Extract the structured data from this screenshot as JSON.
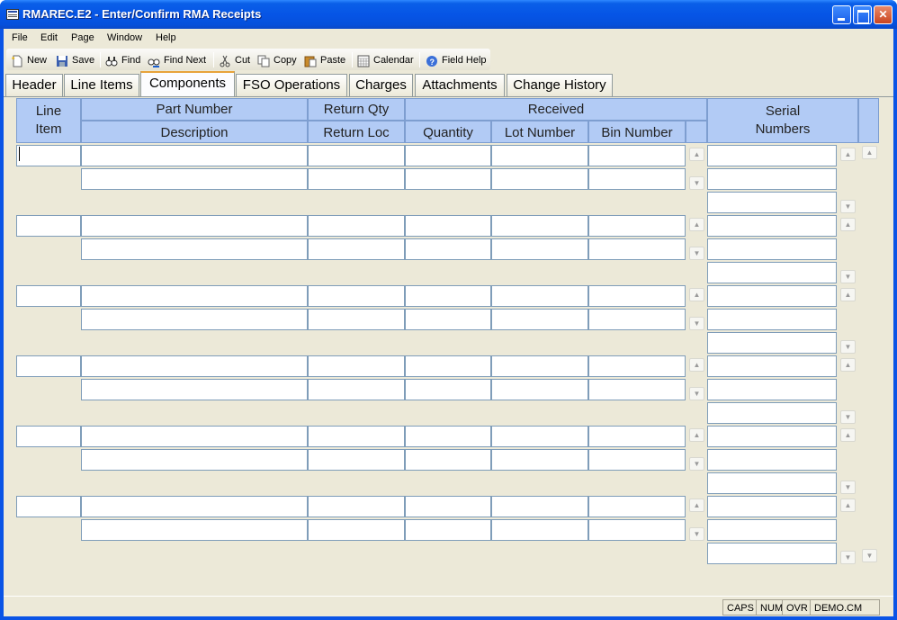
{
  "window": {
    "title": "RMAREC.E2 - Enter/Confirm RMA Receipts"
  },
  "menu": [
    {
      "name": "menu-file",
      "label": "File"
    },
    {
      "name": "menu-edit",
      "label": "Edit"
    },
    {
      "name": "menu-page",
      "label": "Page"
    },
    {
      "name": "menu-window",
      "label": "Window"
    },
    {
      "name": "menu-help",
      "label": "Help"
    }
  ],
  "toolbar": {
    "new": "New",
    "save": "Save",
    "find": "Find",
    "find_next": "Find Next",
    "cut": "Cut",
    "copy": "Copy",
    "paste": "Paste",
    "calendar": "Calendar",
    "field_help": "Field Help"
  },
  "icons": {
    "new": "new-document-icon",
    "save": "floppy-disk-icon",
    "find": "binoculars-icon",
    "find_next": "binoculars-next-icon",
    "cut": "scissors-icon",
    "copy": "copy-icon",
    "paste": "clipboard-paste-icon",
    "calendar": "calendar-icon",
    "field_help": "help-icon"
  },
  "tabs": [
    "Header",
    "Line Items",
    "Components",
    "FSO Operations",
    "Charges",
    "Attachments",
    "Change History"
  ],
  "active_tab": "Components",
  "columns": {
    "line_item": "Line\nItem",
    "part_number": "Part Number",
    "description": "Description",
    "return_qty": "Return Qty",
    "return_loc": "Return Loc",
    "received": "Received",
    "quantity": "Quantity",
    "lot_number": "Lot Number",
    "bin_number": "Bin Number",
    "serial_numbers": "Serial\nNumbers"
  },
  "statusbar": {
    "caps": "CAPS",
    "num": "NUM",
    "ovr": "OVR",
    "account": "DEMO.CM"
  },
  "colors": {
    "title_bar": "#0a54e6",
    "header_bg": "#b2cbf5",
    "active_tab_accent": "#e8a33a",
    "field_border": "#7f9db9"
  }
}
